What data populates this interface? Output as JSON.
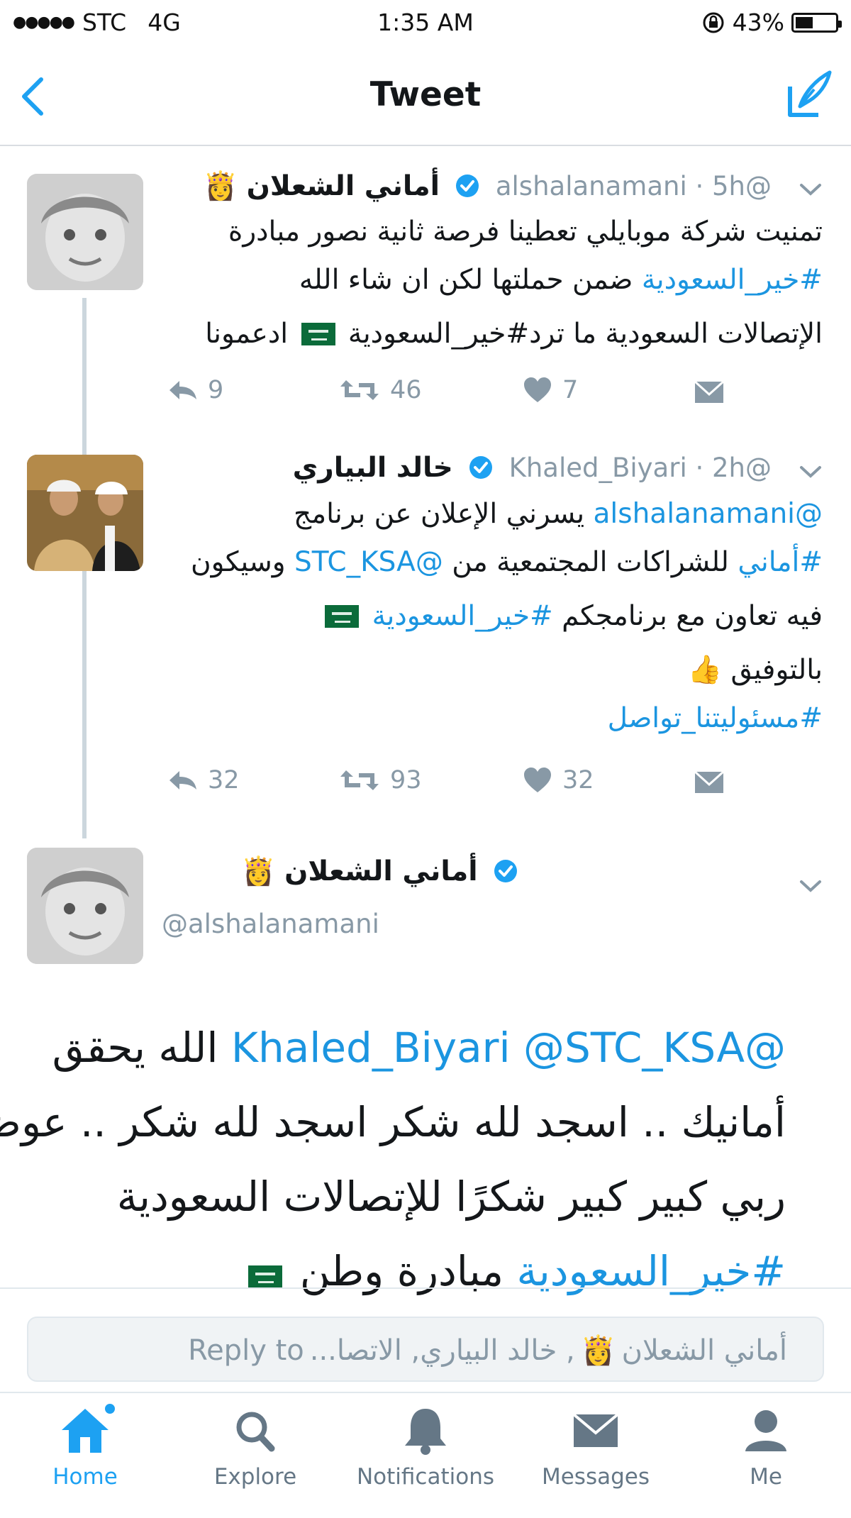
{
  "status_bar": {
    "signal": "●●●●●",
    "carrier": "STC",
    "network": "4G",
    "time": "1:35 AM",
    "battery": "43%"
  },
  "nav": {
    "title": "Tweet"
  },
  "tweets": [
    {
      "name": "أماني الشعلان",
      "handle": "@alshalanamani · 5h",
      "lines": [
        {
          "parts": [
            {
              "text": "تمنيت شركة موبايلي تعطينا فرصة ثانية نصور مبادرة",
              "link": false
            }
          ]
        },
        {
          "parts": [
            {
              "text": "#خير_السعودية",
              "link": true
            },
            {
              "text": " ضمن حملتها لكن ان شاء الله",
              "link": false
            }
          ]
        },
        {
          "parts": [
            {
              "text": "الإتصالات السعودية ما ترد#خير_السعودية ",
              "link": false
            },
            {
              "flag": true
            },
            {
              "text": " ادعمونا",
              "link": false
            }
          ]
        }
      ],
      "actions": {
        "reply": "9",
        "retweet": "46",
        "like": "7"
      }
    },
    {
      "name": "خالد البياري",
      "handle": "@Khaled_Biyari · 2h",
      "lines": [
        {
          "parts": [
            {
              "text": "@alshalanamani",
              "link": true
            },
            {
              "text": " يسرني الإعلان عن برنامج",
              "link": false
            }
          ]
        },
        {
          "parts": [
            {
              "text": "#أماني",
              "link": true
            },
            {
              "text": " للشراكات المجتمعية من ",
              "link": false
            },
            {
              "text": "@STC_KSA",
              "link": true
            },
            {
              "text": " وسيكون",
              "link": false
            }
          ]
        },
        {
          "parts": [
            {
              "text": "فيه تعاون مع برنامجكم ",
              "link": false
            },
            {
              "text": "#خير_السعودية",
              "link": true
            },
            {
              "text": " ",
              "link": false
            },
            {
              "flag": true
            }
          ]
        },
        {
          "parts": [
            {
              "text": "بالتوفيق",
              "link": false
            },
            {
              "text": " 👍",
              "link": false
            }
          ]
        },
        {
          "parts": [
            {
              "text": "#مسئوليتنا_تواصل",
              "link": true
            }
          ]
        }
      ],
      "actions": {
        "reply": "32",
        "retweet": "93",
        "like": "32"
      }
    }
  ],
  "main_tweet": {
    "name": "أماني الشعلان",
    "handle": "@alshalanamani",
    "lines": [
      {
        "parts": [
          {
            "text": "@Khaled_Biyari",
            "link": true
          },
          {
            "text": " ",
            "link": false
          },
          {
            "text": "@STC_KSA",
            "link": true
          },
          {
            "text": " الله يحقق",
            "link": false
          }
        ]
      },
      {
        "parts": [
          {
            "text": "أمانيك .. اسجد لله شكر اسجد لله شكر .. عوض",
            "link": false
          }
        ]
      },
      {
        "parts": [
          {
            "text": "ربي كبير كبير شكرًا للإتصالات السعودية",
            "link": false
          }
        ]
      },
      {
        "parts": [
          {
            "text": "#خير_السعودية",
            "link": true
          },
          {
            "text": " مبادرة وطن ",
            "link": false
          },
          {
            "flag": true
          }
        ]
      }
    ]
  },
  "reply": {
    "prefix": "Reply to",
    "names_first": "أماني الشعلان",
    "names_rest": ", خالد البياري, الاتصا..."
  },
  "tabs": [
    {
      "label": "Home",
      "icon": "home-icon"
    },
    {
      "label": "Explore",
      "icon": "search-icon"
    },
    {
      "label": "Notifications",
      "icon": "bell-icon"
    },
    {
      "label": "Messages",
      "icon": "envelope-icon"
    },
    {
      "label": "Me",
      "icon": "person-icon"
    }
  ],
  "colors": {
    "link": "#1b95e0",
    "accent": "#1da1f2",
    "verified": "#1da1f2",
    "muted": "#8899a6"
  }
}
